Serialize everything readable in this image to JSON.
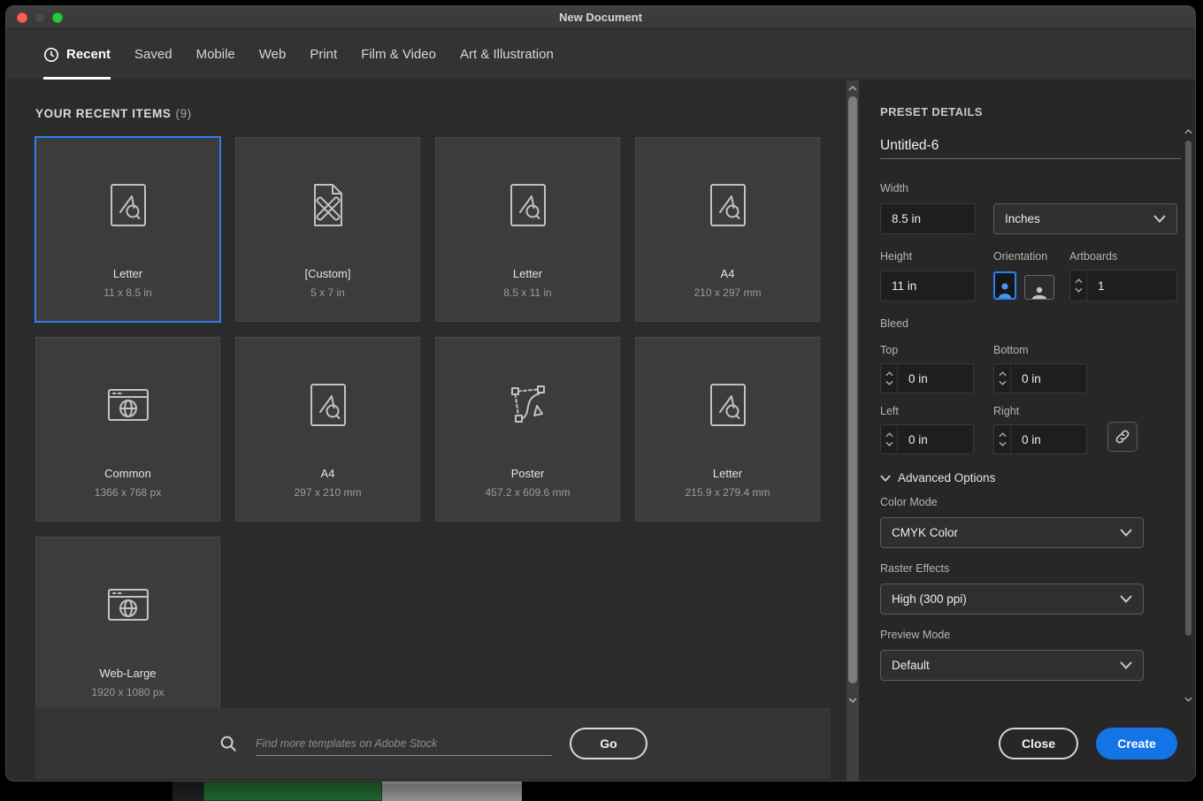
{
  "window": {
    "title": "New Document"
  },
  "tabs": [
    {
      "label": "Recent",
      "active": true
    },
    {
      "label": "Saved"
    },
    {
      "label": "Mobile"
    },
    {
      "label": "Web"
    },
    {
      "label": "Print"
    },
    {
      "label": "Film & Video"
    },
    {
      "label": "Art & Illustration"
    }
  ],
  "recent": {
    "heading": "YOUR RECENT ITEMS",
    "count": "(9)",
    "items": [
      {
        "name": "Letter",
        "dims": "11 x 8.5 in",
        "icon": "artboard",
        "selected": true
      },
      {
        "name": "[Custom]",
        "dims": "5 x 7 in",
        "icon": "custom"
      },
      {
        "name": "Letter",
        "dims": "8.5 x 11 in",
        "icon": "artboard"
      },
      {
        "name": "A4",
        "dims": "210 x 297 mm",
        "icon": "artboard"
      },
      {
        "name": "Common",
        "dims": "1366 x 768 px",
        "icon": "web"
      },
      {
        "name": "A4",
        "dims": "297 x 210 mm",
        "icon": "artboard"
      },
      {
        "name": "Poster",
        "dims": "457.2 x 609.6 mm",
        "icon": "pen"
      },
      {
        "name": "Letter",
        "dims": "215.9 x 279.4 mm",
        "icon": "artboard"
      },
      {
        "name": "Web-Large",
        "dims": "1920 x 1080 px",
        "icon": "web"
      }
    ]
  },
  "search": {
    "placeholder": "Find more templates on Adobe Stock",
    "go": "Go"
  },
  "preset": {
    "heading": "PRESET DETAILS",
    "name": "Untitled-6",
    "width": {
      "label": "Width",
      "value": "8.5 in"
    },
    "units": {
      "value": "Inches"
    },
    "height": {
      "label": "Height",
      "value": "11 in"
    },
    "orientation": {
      "label": "Orientation"
    },
    "artboards": {
      "label": "Artboards",
      "value": "1"
    },
    "bleed": {
      "label": "Bleed",
      "top": {
        "label": "Top",
        "value": "0 in"
      },
      "bottom": {
        "label": "Bottom",
        "value": "0 in"
      },
      "left": {
        "label": "Left",
        "value": "0 in"
      },
      "right": {
        "label": "Right",
        "value": "0 in"
      }
    },
    "advanced": {
      "label": "Advanced Options"
    },
    "color_mode": {
      "label": "Color Mode",
      "value": "CMYK Color"
    },
    "raster": {
      "label": "Raster Effects",
      "value": "High (300 ppi)"
    },
    "preview": {
      "label": "Preview Mode",
      "value": "Default"
    },
    "close": "Close",
    "create": "Create"
  },
  "colors": {
    "accent": "#1473e6",
    "selection": "#2f80ed"
  }
}
